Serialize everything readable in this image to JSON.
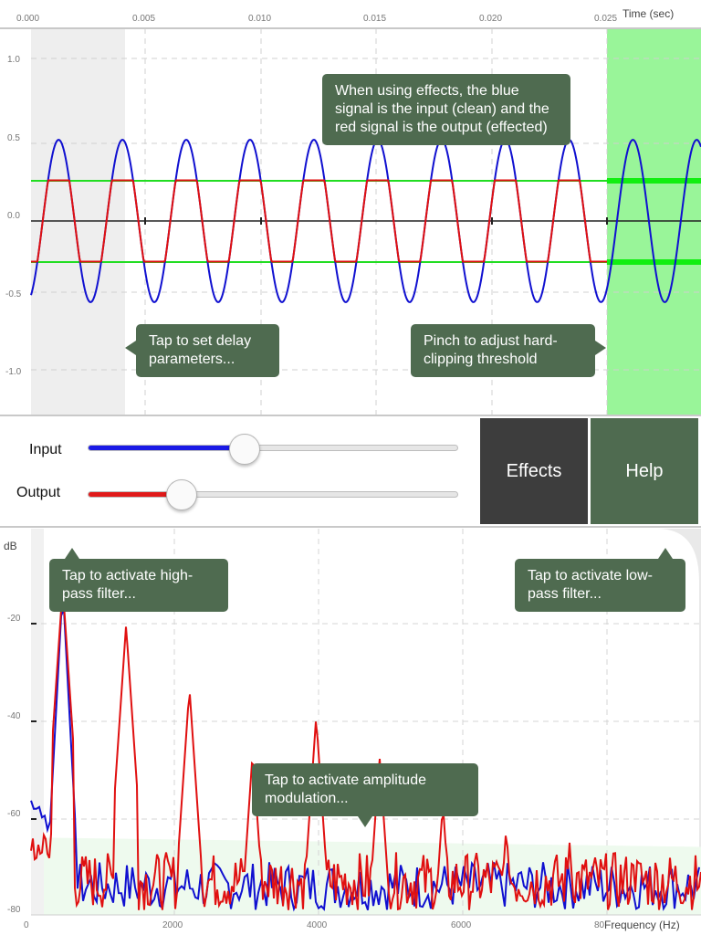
{
  "scope": {
    "time_title": "Time (sec)",
    "time_ticks": [
      "0.000",
      "0.005",
      "0.010",
      "0.015",
      "0.020",
      "0.025"
    ],
    "amp_ticks": [
      "1.0",
      "0.5",
      "0.0",
      "-0.5",
      "-1.0"
    ],
    "input_amplitude": 0.52,
    "clip_threshold": 0.26,
    "cycles_in_view": 10.5,
    "colors": {
      "input": "#1010d0",
      "output": "#e01010",
      "clip": "#22dd22",
      "delay_region": "#eeeeee",
      "clip_region": "#99f599"
    }
  },
  "controls": {
    "input_label": "Input",
    "output_label": "Output",
    "input_level": 0.42,
    "output_level": 0.25,
    "effects_label": "Effects",
    "help_label": "Help",
    "colors": {
      "effects_bg": "#3d3d3d",
      "help_bg": "#4f6b50",
      "input_fill": "#1a1ae6",
      "output_fill": "#e01a1a"
    }
  },
  "spectrum": {
    "db_title": "dB",
    "db_ticks": [
      "-20",
      "-40",
      "-60",
      "-80"
    ],
    "freq_ticks": [
      "0",
      "2000",
      "4000",
      "6000",
      "80"
    ],
    "freq_title": "Frequency (Hz)",
    "fundamental_hz": 440,
    "input_peak_db": -12,
    "harmonic_peaks": [
      {
        "hz": 440,
        "db": -12
      },
      {
        "hz": 1320,
        "db": -20
      },
      {
        "hz": 2200,
        "db": -33
      },
      {
        "hz": 3080,
        "db": -46
      },
      {
        "hz": 3960,
        "db": -39
      },
      {
        "hz": 4840,
        "db": -47
      },
      {
        "hz": 5720,
        "db": -57
      }
    ],
    "noise_floor_db": -72
  },
  "tooltips": {
    "effects_info": "When using effects, the blue signal is the input (clean) and the red signal is the output (effected)",
    "delay": "Tap to set delay parameters...",
    "clipping": "Pinch to adjust hard-clipping threshold",
    "highpass": "Tap to activate high-pass filter...",
    "lowpass": "Tap to activate low-pass filter...",
    "am": "Tap to activate amplitude modulation..."
  }
}
